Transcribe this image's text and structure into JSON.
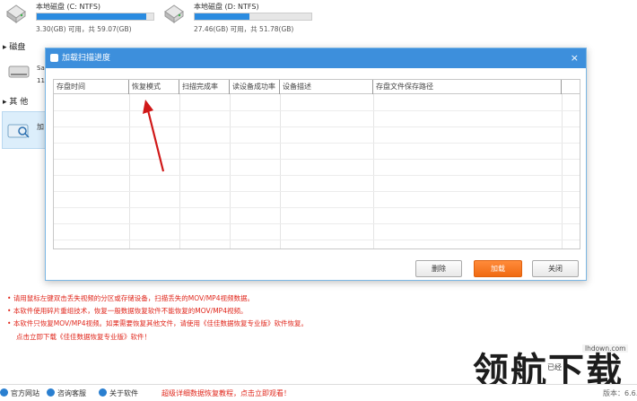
{
  "drives": [
    {
      "name": "本地磁盘 (C: NTFS)",
      "usage": "3.30(GB) 可用，共 59.07(GB)",
      "used_fraction": 0.94
    },
    {
      "name": "本地磁盘 (D: NTFS)",
      "usage": "27.46(GB) 可用，共 51.78(GB)",
      "used_fraction": 0.47
    }
  ],
  "sections": {
    "disk": "磁盘",
    "other": "其 他",
    "sa": "Sa",
    "eleven": "11",
    "jia": "加"
  },
  "dialog": {
    "title": "加载扫描进度",
    "close": "×",
    "columns": [
      "存盘时间",
      "恢复模式",
      "扫描完成率",
      "读设备成功率",
      "设备描述",
      "存盘文件保存路径"
    ],
    "buttons": {
      "delete": "删除",
      "load": "加载",
      "close": "关闭"
    }
  },
  "notes": [
    "请用鼠标左键双击丢失视频的分区或存储设备，扫描丢失的MOV/MP4视频数据。",
    "本软件使用碎片重组技术，恢复一般数据恢复软件不能恢复的MOV/MP4视频。",
    "本软件只恢复MOV/MP4视频。如果需要恢复其他文件，请使用《佳佳数据恢复专业版》软件恢复。",
    "点击立即下载《佳佳数据恢复专业版》软件！"
  ],
  "footer": {
    "website": "官方网站",
    "support": "咨询客服",
    "about": "关于软件",
    "tutorial": "超级详细数据恢复教程，点击立即观看！",
    "version": "版本：6.6.7"
  },
  "watermark": {
    "site": "lhdown.com",
    "brand": "领航下载",
    "small": "已经"
  },
  "colors": {
    "accent": "#3d8fdc",
    "orange": "#f06a12",
    "note_red": "#e0261b"
  }
}
